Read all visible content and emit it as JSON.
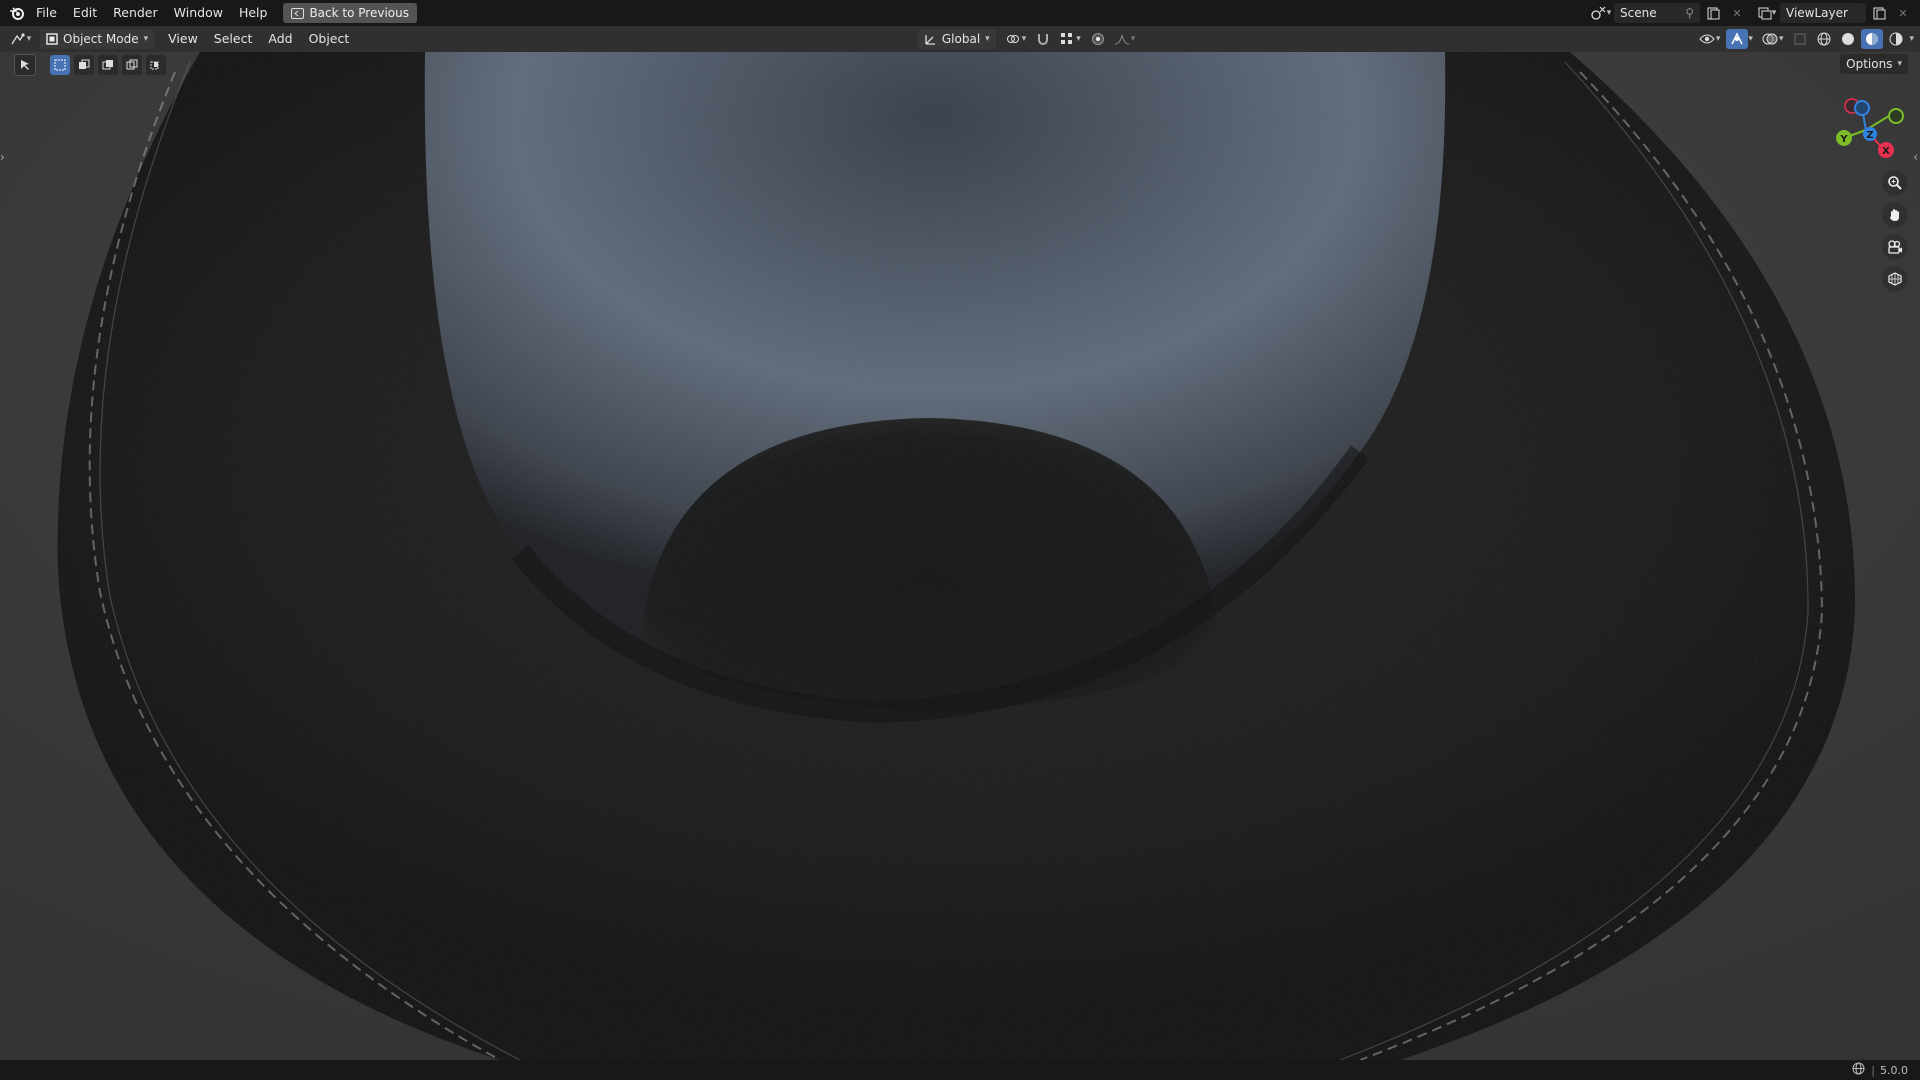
{
  "topbar": {
    "menus": [
      "File",
      "Edit",
      "Render",
      "Window",
      "Help"
    ],
    "back_button": "Back to Previous",
    "scene": "Scene",
    "view_layer": "ViewLayer"
  },
  "header": {
    "mode": "Object Mode",
    "menus": [
      "View",
      "Select",
      "Add",
      "Object"
    ],
    "transform_orientation": "Global"
  },
  "viewport": {
    "options_label": "Options",
    "gizmo_axes": {
      "x": "X",
      "y": "Y",
      "z": "Z"
    }
  },
  "status": {
    "version": "5.0.0"
  },
  "colors": {
    "accent": "#4772b3",
    "axis_x": "#e8304f",
    "axis_y": "#7cbc27",
    "axis_z": "#2f83e3"
  }
}
